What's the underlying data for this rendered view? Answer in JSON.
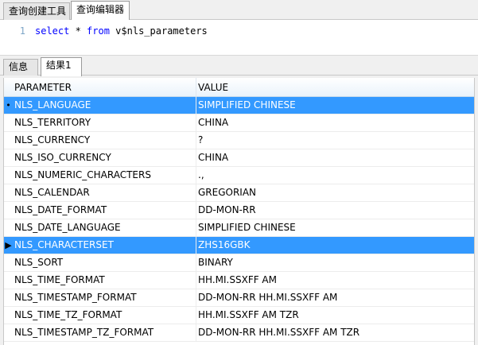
{
  "top_tabs": [
    {
      "label": "查询创建工具",
      "active": false
    },
    {
      "label": "查询编辑器",
      "active": true
    }
  ],
  "editor": {
    "line_number": "1",
    "kw_select": "select",
    "star": " * ",
    "kw_from": "from",
    "table": " v$nls_parameters"
  },
  "result_tabs": [
    {
      "label": "信息",
      "active": false
    },
    {
      "label": "结果1",
      "active": true
    }
  ],
  "grid": {
    "columns": [
      "PARAMETER",
      "VALUE"
    ],
    "rows": [
      {
        "parameter": "NLS_LANGUAGE",
        "value": "SIMPLIFIED CHINESE",
        "indicator": "•",
        "selected": true
      },
      {
        "parameter": "NLS_TERRITORY",
        "value": "CHINA",
        "indicator": "",
        "selected": false
      },
      {
        "parameter": "NLS_CURRENCY",
        "value": "?",
        "indicator": "",
        "selected": false
      },
      {
        "parameter": "NLS_ISO_CURRENCY",
        "value": "CHINA",
        "indicator": "",
        "selected": false
      },
      {
        "parameter": "NLS_NUMERIC_CHARACTERS",
        "value": ".,",
        "indicator": "",
        "selected": false
      },
      {
        "parameter": "NLS_CALENDAR",
        "value": "GREGORIAN",
        "indicator": "",
        "selected": false
      },
      {
        "parameter": "NLS_DATE_FORMAT",
        "value": "DD-MON-RR",
        "indicator": "",
        "selected": false
      },
      {
        "parameter": "NLS_DATE_LANGUAGE",
        "value": "SIMPLIFIED CHINESE",
        "indicator": "",
        "selected": false
      },
      {
        "parameter": "NLS_CHARACTERSET",
        "value": "ZHS16GBK",
        "indicator": "▶",
        "selected": true
      },
      {
        "parameter": "NLS_SORT",
        "value": "BINARY",
        "indicator": "",
        "selected": false
      },
      {
        "parameter": "NLS_TIME_FORMAT",
        "value": "HH.MI.SSXFF AM",
        "indicator": "",
        "selected": false
      },
      {
        "parameter": "NLS_TIMESTAMP_FORMAT",
        "value": "DD-MON-RR HH.MI.SSXFF AM",
        "indicator": "",
        "selected": false
      },
      {
        "parameter": "NLS_TIME_TZ_FORMAT",
        "value": "HH.MI.SSXFF AM TZR",
        "indicator": "",
        "selected": false
      },
      {
        "parameter": "NLS_TIMESTAMP_TZ_FORMAT",
        "value": "DD-MON-RR HH.MI.SSXFF AM TZR",
        "indicator": "",
        "selected": false
      }
    ]
  }
}
